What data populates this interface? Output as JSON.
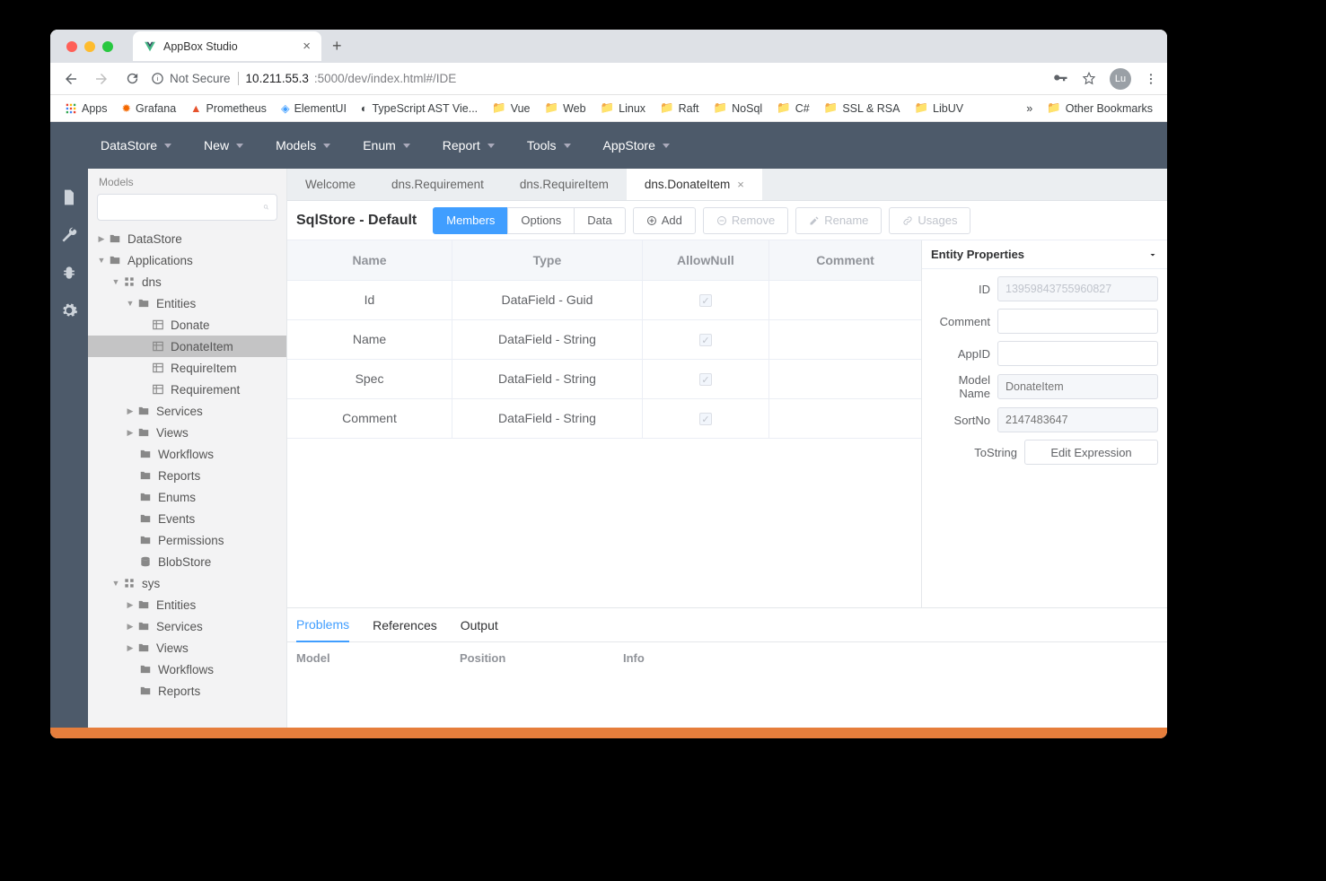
{
  "browser": {
    "tab_title": "AppBox Studio",
    "url_label_notsecure": "Not Secure",
    "url_host": "10.211.55.3",
    "url_path": ":5000/dev/index.html#/IDE",
    "avatar": "Lu",
    "bookmarks": {
      "apps": "Apps",
      "items": [
        "Grafana",
        "Prometheus",
        "ElementUI",
        "TypeScript AST Vie...",
        "Vue",
        "Web",
        "Linux",
        "Raft",
        "NoSql",
        "C#",
        "SSL & RSA",
        "LibUV"
      ],
      "more": "»",
      "other": "Other Bookmarks"
    }
  },
  "menu": [
    "DataStore",
    "New",
    "Models",
    "Enum",
    "Report",
    "Tools",
    "AppStore"
  ],
  "sidebar": {
    "title": "Models",
    "search_placeholder": "",
    "tree": {
      "datastore": "DataStore",
      "applications": "Applications",
      "dns": "dns",
      "entities": "Entities",
      "entity_items": [
        "Donate",
        "DonateItem",
        "RequireItem",
        "Requirement"
      ],
      "services": "Services",
      "views": "Views",
      "workflows": "Workflows",
      "reports": "Reports",
      "enums": "Enums",
      "events": "Events",
      "permissions": "Permissions",
      "blobstore": "BlobStore",
      "sys": "sys",
      "sys_entities": "Entities",
      "sys_services": "Services",
      "sys_views": "Views",
      "sys_workflows": "Workflows",
      "sys_reports": "Reports"
    }
  },
  "editor_tabs": [
    {
      "label": "Welcome",
      "closable": false
    },
    {
      "label": "dns.Requirement",
      "closable": false
    },
    {
      "label": "dns.RequireItem",
      "closable": false
    },
    {
      "label": "dns.DonateItem",
      "closable": true
    }
  ],
  "toolbar": {
    "title": "SqlStore - Default",
    "members": "Members",
    "options": "Options",
    "data": "Data",
    "add": "Add",
    "remove": "Remove",
    "rename": "Rename",
    "usages": "Usages"
  },
  "table": {
    "headers": [
      "Name",
      "Type",
      "AllowNull",
      "Comment"
    ],
    "rows": [
      {
        "name": "Id",
        "type": "DataField - Guid",
        "allownull": true,
        "comment": ""
      },
      {
        "name": "Name",
        "type": "DataField - String",
        "allownull": true,
        "comment": ""
      },
      {
        "name": "Spec",
        "type": "DataField - String",
        "allownull": true,
        "comment": ""
      },
      {
        "name": "Comment",
        "type": "DataField - String",
        "allownull": true,
        "comment": ""
      }
    ]
  },
  "props": {
    "title": "Entity Properties",
    "id_label": "ID",
    "id": "13959843755960827",
    "comment_label": "Comment",
    "comment": "",
    "appid_label": "AppID",
    "appid": "",
    "modelname_label": "Model Name",
    "modelname_placeholder": "DonateItem",
    "sortno_label": "SortNo",
    "sortno_placeholder": "2147483647",
    "tostring_label": "ToString",
    "tostring_button": "Edit Expression"
  },
  "bottom_panel": {
    "tabs": [
      "Problems",
      "References",
      "Output"
    ],
    "cols": [
      "Model",
      "Position",
      "Info"
    ]
  }
}
